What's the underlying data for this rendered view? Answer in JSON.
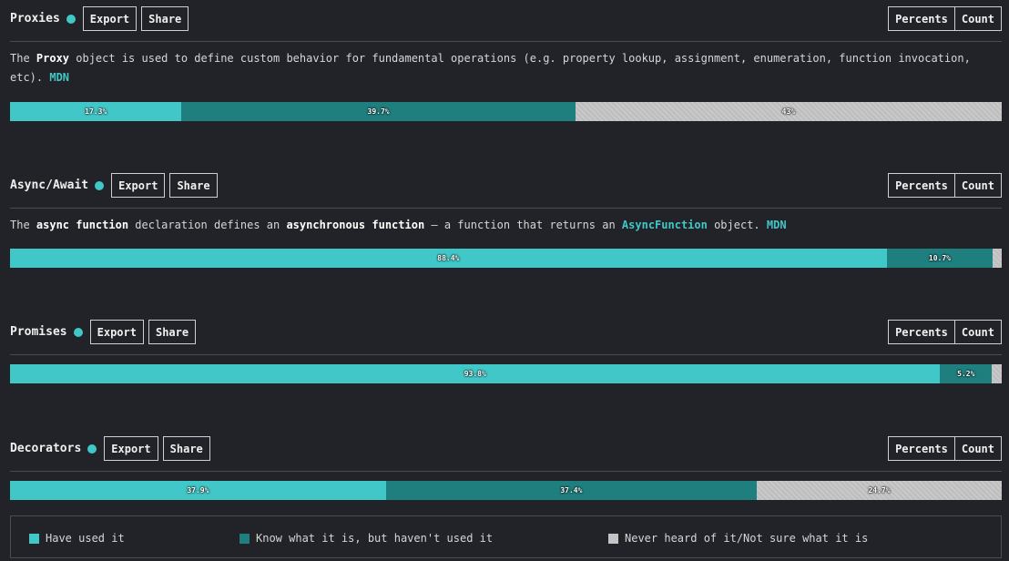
{
  "sections": [
    {
      "title": "Proxies",
      "export_label": "Export",
      "share_label": "Share",
      "percents_label": "Percents",
      "count_label": "Count",
      "description_line1": [
        "The ",
        "Proxy",
        " object is used to define custom behavior for fundamental operations (e.g. property lookup, assignment, enumeration, function invocation,"
      ],
      "description_line2": [
        "etc). ",
        "MDN"
      ]
    },
    {
      "title": "Async/Await",
      "export_label": "Export",
      "share_label": "Share",
      "percents_label": "Percents",
      "count_label": "Count",
      "description_parts": [
        "The ",
        "async function",
        " declaration defines an ",
        "asynchronous function",
        " — a function that returns an ",
        "AsyncFunction",
        " object. ",
        "MDN"
      ]
    },
    {
      "title": "Promises",
      "export_label": "Export",
      "share_label": "Share",
      "percents_label": "Percents",
      "count_label": "Count"
    },
    {
      "title": "Decorators",
      "export_label": "Export",
      "share_label": "Share",
      "percents_label": "Percents",
      "count_label": "Count"
    }
  ],
  "chart_data": {
    "type": "bar",
    "stacked": true,
    "orientation": "horizontal",
    "unit": "percent",
    "categories": [
      "Proxies",
      "Async/Await",
      "Promises",
      "Decorators"
    ],
    "series": [
      {
        "name": "Have used it",
        "color": "#41c7c7",
        "values": [
          17.3,
          88.4,
          93.8,
          37.9
        ],
        "labels": [
          "17.3%",
          "88.4%",
          "93.8%",
          "37.9%"
        ]
      },
      {
        "name": "Know what it is, but haven't used it",
        "color": "#1f7e7e",
        "values": [
          39.7,
          10.7,
          5.2,
          37.4
        ],
        "labels": [
          "39.7%",
          "10.7%",
          "5.2%",
          "37.4%"
        ]
      },
      {
        "name": "Never heard of it/Not sure what it is",
        "color": "#c4c4c4",
        "values": [
          43,
          0.9,
          1.0,
          24.7
        ],
        "labels": [
          "43%",
          "",
          "",
          "24.7%"
        ]
      }
    ],
    "legend_position": "bottom"
  },
  "legend": {
    "items": [
      {
        "label": "Have used it",
        "color": "#41c7c7"
      },
      {
        "label": "Know what it is, but haven't used it",
        "color": "#1f7e7e"
      },
      {
        "label": "Never heard of it/Not sure what it is",
        "color": "#c4c4c4"
      }
    ]
  }
}
